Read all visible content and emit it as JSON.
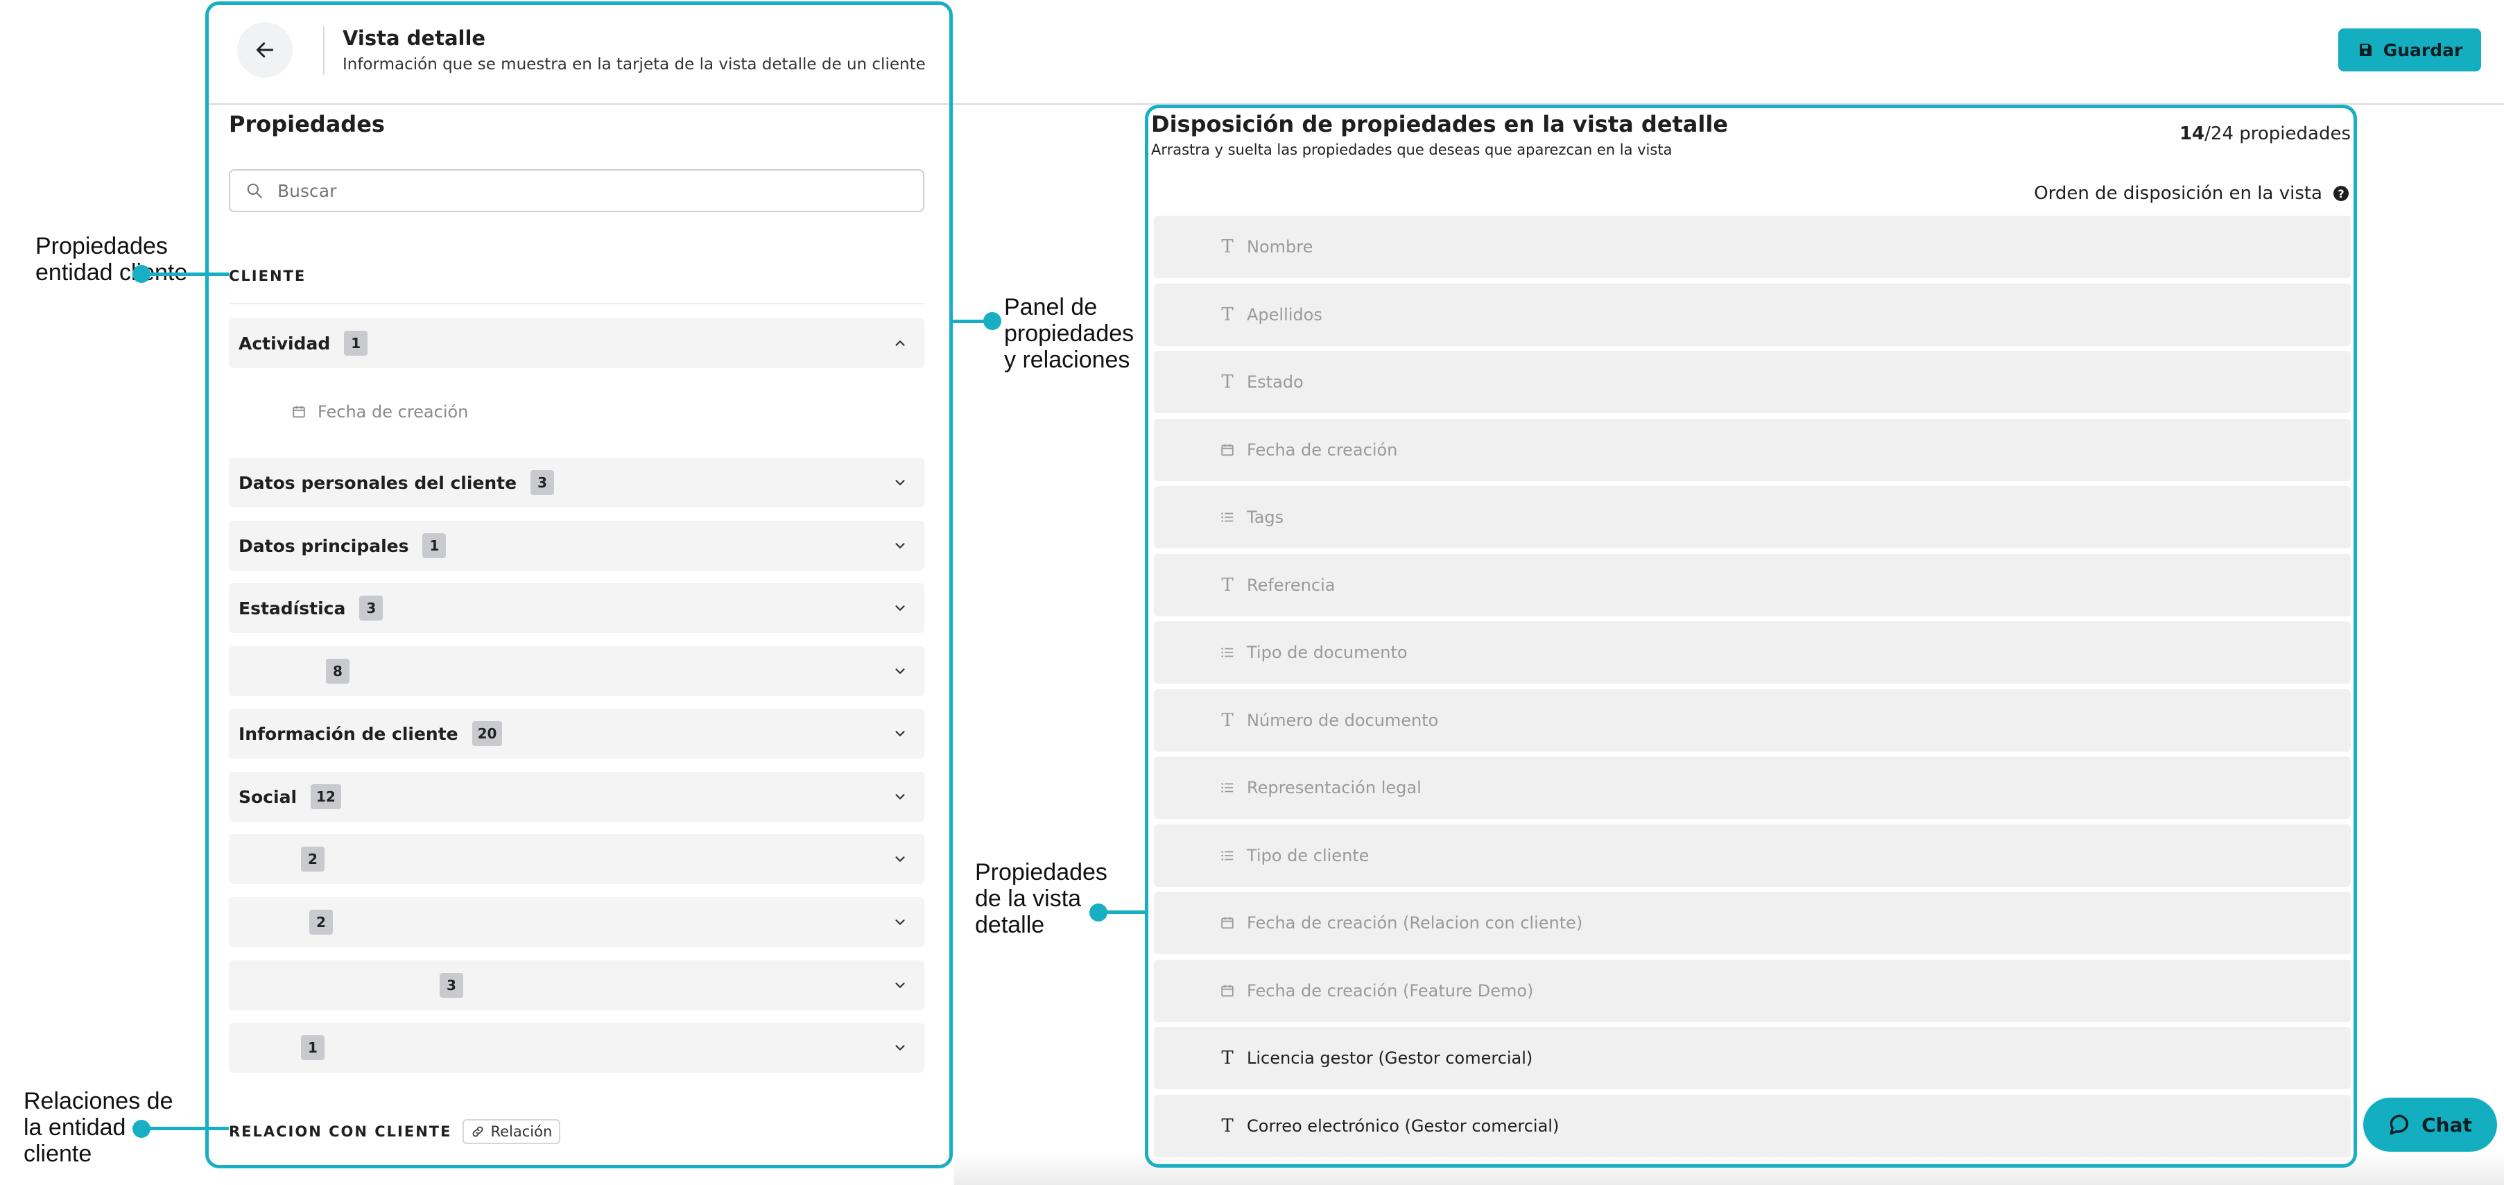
{
  "header": {
    "title": "Vista detalle",
    "subtitle": "Información que se muestra en la tarjeta de la vista detalle de un cliente",
    "save_label": "Guardar"
  },
  "left_panel": {
    "title": "Propiedades",
    "search_placeholder": "Buscar",
    "section_cliente": "CLIENTE",
    "groups": [
      {
        "label": "Actividad",
        "count": "1",
        "expanded": true
      },
      {
        "label": "Datos personales del cliente",
        "count": "3"
      },
      {
        "label": "Datos principales",
        "count": "1"
      },
      {
        "label": "Estadística",
        "count": "3"
      },
      {
        "label": "",
        "count": "8"
      },
      {
        "label": "Información de cliente",
        "count": "20"
      },
      {
        "label": "Social",
        "count": "12"
      },
      {
        "label": "",
        "count": "2"
      },
      {
        "label": "",
        "count": "2"
      },
      {
        "label": "",
        "count": "3"
      },
      {
        "label": "",
        "count": "1"
      }
    ],
    "actividad_items": [
      "Fecha de creación"
    ],
    "section_relacion": "RELACION CON CLIENTE",
    "relation_tag": "Relación"
  },
  "right_panel": {
    "title": "Disposición de propiedades en la vista detalle",
    "subtitle": "Arrastra y suelta las propiedades que deseas que aparezcan en la vista",
    "count_selected": "14",
    "count_rest": "/24 propiedades",
    "order_label": "Orden de disposición en la vista",
    "properties": [
      {
        "label": "Nombre",
        "icon": "text-icon",
        "active": false
      },
      {
        "label": "Apellidos",
        "icon": "text-icon",
        "active": false
      },
      {
        "label": "Estado",
        "icon": "text-icon",
        "active": false
      },
      {
        "label": "Fecha de creación",
        "icon": "calendar-icon",
        "active": false
      },
      {
        "label": "Tags",
        "icon": "list-icon",
        "active": false
      },
      {
        "label": "Referencia",
        "icon": "text-icon",
        "active": false
      },
      {
        "label": "Tipo de documento",
        "icon": "list-icon",
        "active": false
      },
      {
        "label": "Número de documento",
        "icon": "text-icon",
        "active": false
      },
      {
        "label": "Representación legal",
        "icon": "list-icon",
        "active": false
      },
      {
        "label": "Tipo de cliente",
        "icon": "list-icon",
        "active": false
      },
      {
        "label": "Fecha de creación (Relacion con cliente)",
        "icon": "calendar-icon",
        "active": false
      },
      {
        "label": "Fecha de creación (Feature Demo)",
        "icon": "calendar-icon",
        "active": false
      },
      {
        "label": "Licencia gestor (Gestor comercial)",
        "icon": "text-icon",
        "active": true
      },
      {
        "label": "Correo electrónico (Gestor comercial)",
        "icon": "text-icon",
        "active": true
      }
    ]
  },
  "chat": {
    "label": "Chat"
  },
  "annotations": {
    "entidad": "Propiedades entidad cliente",
    "panel": "Panel de propiedades y relaciones",
    "vista": "Propiedades de la vista detalle",
    "relaciones": "Relaciones de la entidad cliente"
  },
  "colors": {
    "accent": "#18afc4",
    "button": "#13aebf"
  }
}
